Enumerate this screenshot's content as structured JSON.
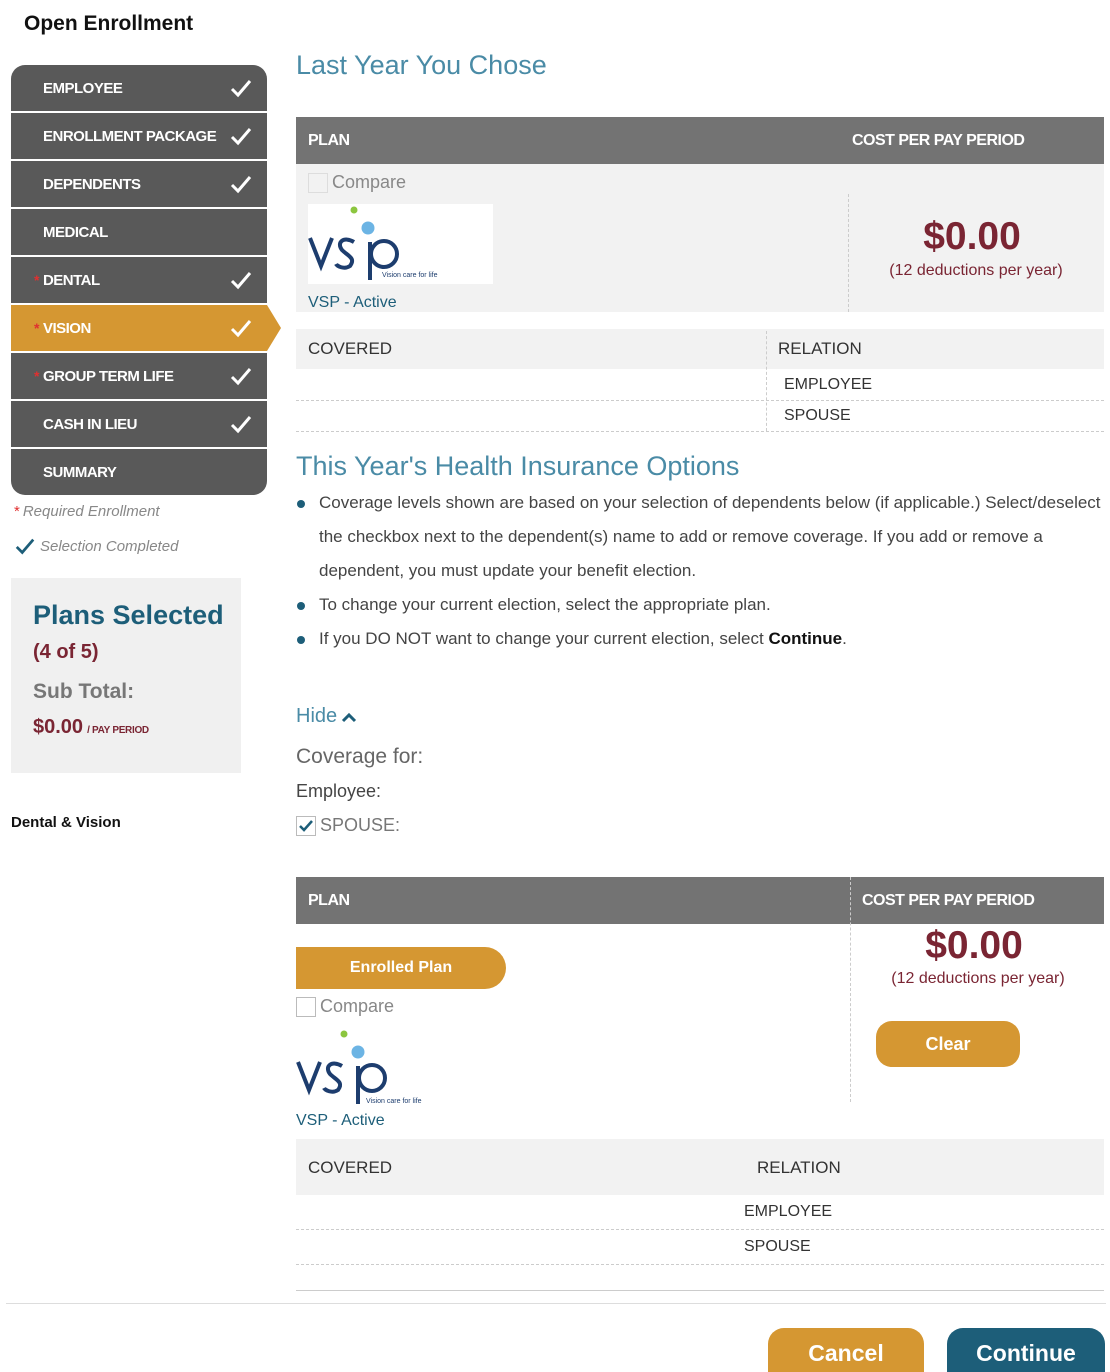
{
  "app": {
    "title": "Open Enrollment"
  },
  "sidebar": {
    "steps": [
      {
        "label": "EMPLOYEE",
        "required": false,
        "completed": true,
        "active": false
      },
      {
        "label": "ENROLLMENT PACKAGE",
        "required": false,
        "completed": true,
        "active": false
      },
      {
        "label": "DEPENDENTS",
        "required": false,
        "completed": true,
        "active": false
      },
      {
        "label": "MEDICAL",
        "required": false,
        "completed": false,
        "active": false
      },
      {
        "label": "DENTAL",
        "required": true,
        "completed": true,
        "active": false
      },
      {
        "label": "VISION",
        "required": true,
        "completed": true,
        "active": true
      },
      {
        "label": "GROUP TERM LIFE",
        "required": true,
        "completed": true,
        "active": false
      },
      {
        "label": "CASH IN LIEU",
        "required": false,
        "completed": true,
        "active": false
      },
      {
        "label": "SUMMARY",
        "required": false,
        "completed": false,
        "active": false
      }
    ],
    "legend_required": "Required Enrollment",
    "legend_required_mark": "*",
    "legend_completed": "Selection Completed",
    "plans_selected_title": "Plans Selected",
    "plans_selected_count": "(4 of 5)",
    "subtotal_label": "Sub Total:",
    "subtotal_amount": "$0.00",
    "subtotal_unit": "/ PAY PERIOD",
    "footer_label": "Dental & Vision"
  },
  "last_year": {
    "title": "Last Year You Chose",
    "plan_header": "PLAN",
    "cost_header": "COST PER PAY PERIOD",
    "compare_label": "Compare",
    "logo_text": "vsp",
    "logo_tagline": "Vision care for life",
    "plan_name": "VSP - Active",
    "price": "$0.00",
    "deductions": "(12 deductions per year)",
    "covered_header": "COVERED",
    "relation_header": "RELATION",
    "relations": [
      "EMPLOYEE",
      "SPOUSE"
    ]
  },
  "this_year": {
    "title": "This Year's Health Insurance Options",
    "bullet1": "Coverage levels shown are based on your selection of dependents below (if applicable.) Select/deselect the checkbox next to the dependent(s) name to add or remove coverage. If you add or remove a dependent, you must update your benefit election.",
    "bullet2": "To change your current election, select the appropriate plan.",
    "bullet3_pre": "If you DO NOT want to change your current election, select ",
    "bullet3_bold": "Continue",
    "bullet3_post": ".",
    "hide_label": "Hide",
    "coverage_for": "Coverage for:",
    "employee_label": "Employee:",
    "spouse_label": "SPOUSE:",
    "spouse_checked": true,
    "plan_header": "PLAN",
    "cost_header": "COST PER PAY PERIOD",
    "enrolled_label": "Enrolled Plan",
    "compare_label": "Compare",
    "logo_text": "vsp",
    "logo_tagline": "Vision care for life",
    "plan_name": "VSP - Active",
    "price": "$0.00",
    "deductions": "(12 deductions per year)",
    "clear_label": "Clear",
    "covered_header": "COVERED",
    "relation_header": "RELATION",
    "relations": [
      "EMPLOYEE",
      "SPOUSE"
    ]
  },
  "footer": {
    "cancel_label": "Cancel",
    "continue_label": "Continue"
  },
  "colors": {
    "accent": "#d59732",
    "primary": "#1d5e79",
    "price": "#7a2533",
    "step": "#595959"
  }
}
